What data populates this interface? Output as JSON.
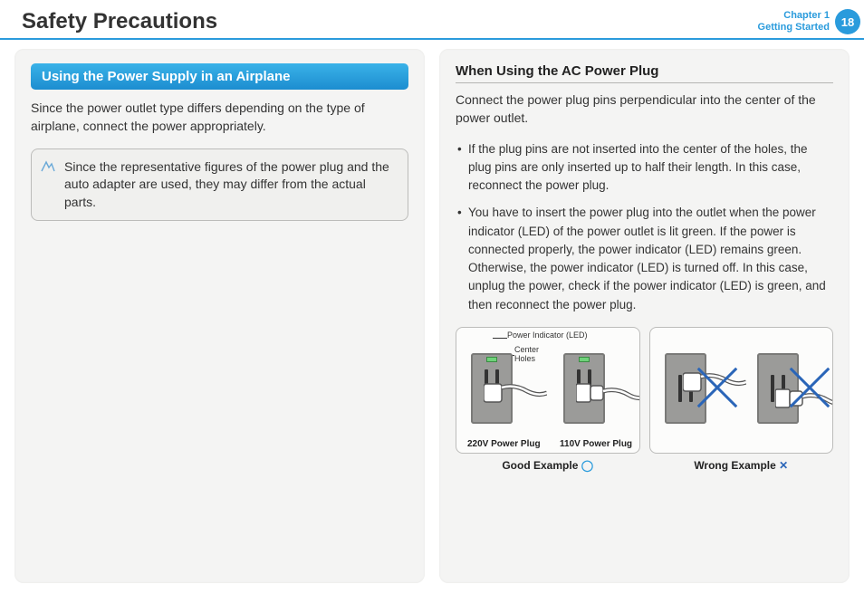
{
  "header": {
    "title": "Safety Precautions",
    "chapter_line1": "Chapter 1",
    "chapter_line2": "Getting Started",
    "page_number": "18"
  },
  "left": {
    "banner": "Using the Power Supply in an Airplane",
    "lead": "Since the power outlet type differs depending on the type of airplane, connect the power appropriately.",
    "note": "Since the representative figures of the power plug and the auto adapter are used, they may differ from the actual parts."
  },
  "right": {
    "subhead": "When Using the AC Power Plug",
    "lead": "Connect the power plug pins perpendicular into the center of the power outlet.",
    "bullets": [
      "If the plug pins are not inserted into the center of the holes, the plug pins are only inserted up to half their length. In this case, reconnect the power plug.",
      "You have to insert the power plug into the outlet when the power indicator (LED) of the power outlet is lit green. If the power is connected properly, the power indicator (LED) remains green.\nOtherwise, the power indicator (LED) is turned off. In this case, unplug the power, check if the power indicator (LED) is green, and then reconnect the power plug."
    ],
    "figure": {
      "annot_led": "Power Indicator (LED)",
      "annot_center": "Center",
      "annot_holes": "Holes",
      "plug_220": "220V Power Plug",
      "plug_110": "110V Power Plug",
      "good_caption": "Good Example",
      "wrong_caption": "Wrong Example"
    }
  }
}
